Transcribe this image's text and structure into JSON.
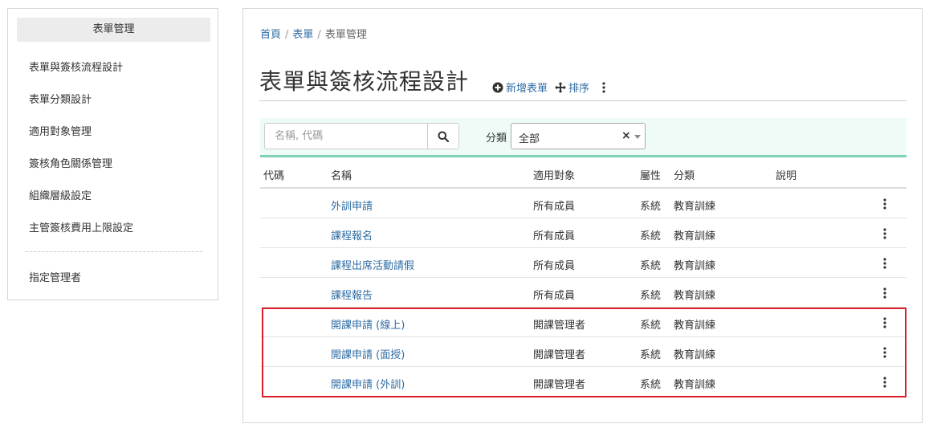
{
  "sidebar": {
    "header": "表單管理",
    "items": [
      {
        "label": "表單與簽核流程設計"
      },
      {
        "label": "表單分類設計"
      },
      {
        "label": "適用對象管理"
      },
      {
        "label": "簽核角色關係管理"
      },
      {
        "label": "組織層級設定"
      },
      {
        "label": "主管簽核費用上限設定"
      }
    ],
    "footer_item": "指定管理者"
  },
  "breadcrumb": {
    "home": "首頁",
    "forms": "表單",
    "current": "表單管理"
  },
  "page": {
    "title": "表單與簽核流程設計",
    "add_label": "新增表單",
    "sort_label": "排序"
  },
  "filter": {
    "search_placeholder": "名稱, 代碼",
    "category_label": "分類",
    "category_value": "全部",
    "clear_symbol": "×"
  },
  "table": {
    "headers": {
      "code": "代碼",
      "name": "名稱",
      "target": "適用對象",
      "attr": "屬性",
      "category": "分類",
      "desc": "說明"
    },
    "rows": [
      {
        "code": "",
        "name": "外訓申請",
        "target": "所有成員",
        "attr": "系統",
        "category": "教育訓練",
        "desc": ""
      },
      {
        "code": "",
        "name": "課程報名",
        "target": "所有成員",
        "attr": "系統",
        "category": "教育訓練",
        "desc": ""
      },
      {
        "code": "",
        "name": "課程出席活動請假",
        "target": "所有成員",
        "attr": "系統",
        "category": "教育訓練",
        "desc": ""
      },
      {
        "code": "",
        "name": "課程報告",
        "target": "所有成員",
        "attr": "系統",
        "category": "教育訓練",
        "desc": ""
      },
      {
        "code": "",
        "name": "開課申請 (線上)",
        "target": "開課管理者",
        "attr": "系統",
        "category": "教育訓練",
        "desc": ""
      },
      {
        "code": "",
        "name": "開課申請 (面授)",
        "target": "開課管理者",
        "attr": "系統",
        "category": "教育訓練",
        "desc": ""
      },
      {
        "code": "",
        "name": "開課申請 (外訓)",
        "target": "開課管理者",
        "attr": "系統",
        "category": "教育訓練",
        "desc": ""
      }
    ]
  },
  "colors": {
    "link": "#2e6da4",
    "filter_bg": "#eefbf6",
    "filter_accent": "#7fd1b8",
    "highlight": "#d9202a"
  },
  "icons": {
    "add": "plus-circle-icon",
    "sort": "move-arrows-icon",
    "more": "vertical-ellipsis-icon",
    "search": "search-icon"
  }
}
